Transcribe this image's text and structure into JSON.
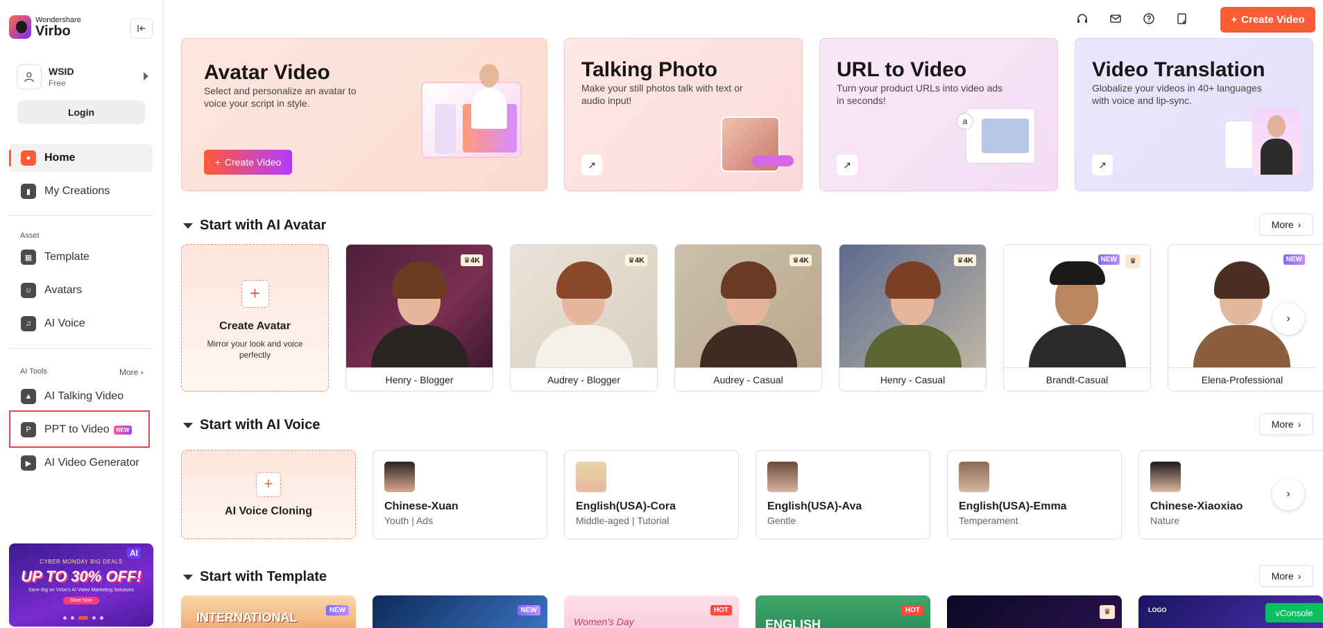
{
  "app": {
    "brand": "Wondershare",
    "product": "Virbo",
    "accent_color": "#ff5a36"
  },
  "user": {
    "name": "WSID",
    "plan": "Free",
    "login_label": "Login"
  },
  "sidebar": {
    "main_items": [
      {
        "label": "Home",
        "icon": "home-icon",
        "active": true
      },
      {
        "label": "My Creations",
        "icon": "folder-icon",
        "active": false
      }
    ],
    "asset_label": "Asset",
    "asset_items": [
      {
        "label": "Template",
        "icon": "template-icon"
      },
      {
        "label": "Avatars",
        "icon": "avatar-icon"
      },
      {
        "label": "AI Voice",
        "icon": "voice-icon"
      }
    ],
    "tools_label": "AI Tools",
    "tools_more": "More",
    "tool_items": [
      {
        "label": "AI Talking Video",
        "icon": "talking-video-icon"
      },
      {
        "label": "PPT to Video",
        "icon": "ppt-icon",
        "badge": "NEW"
      },
      {
        "label": "AI Video Generator",
        "icon": "video-generator-icon"
      }
    ],
    "promo": {
      "line1": "CYBER MONDAY BIG DEALS",
      "line2": "UP TO 30% OFF!",
      "line3": "Save Big on Virbo's AI Video Marketing Solutions",
      "cta": "Save Now",
      "tag": "AI"
    }
  },
  "topbar": {
    "icons": [
      "headset-icon",
      "mail-icon",
      "help-icon",
      "download-icon"
    ],
    "create_label": "Create Video"
  },
  "features": [
    {
      "title": "Avatar Video",
      "desc": "Select and personalize an avatar to voice your script in style.",
      "button": "Create Video"
    },
    {
      "title": "Talking Photo",
      "desc": "Make your still photos talk with text or audio input!"
    },
    {
      "title": "URL to Video",
      "desc": "Turn your product URLs into video ads in seconds!"
    },
    {
      "title": "Video Translation",
      "desc": "Globalize your videos in 40+ languages with voice and lip-sync."
    }
  ],
  "avatar_section": {
    "title": "Start with AI Avatar",
    "more": "More",
    "create_title": "Create Avatar",
    "create_desc": "Mirror your look and voice perfectly",
    "avatars": [
      {
        "name": "Henry - Blogger",
        "badge": "4K"
      },
      {
        "name": "Audrey - Blogger",
        "badge": "4K"
      },
      {
        "name": "Audrey - Casual",
        "badge": "4K"
      },
      {
        "name": "Henry - Casual",
        "badge": "4K"
      },
      {
        "name": "Brandt-Casual",
        "badge": "NEW"
      },
      {
        "name": "Elena-Professional",
        "badge": "NEW"
      }
    ]
  },
  "voice_section": {
    "title": "Start with AI Voice",
    "more": "More",
    "create_title": "AI Voice Cloning",
    "voices": [
      {
        "name": "Chinese-Xuan",
        "tags": "Youth | Ads"
      },
      {
        "name": "English(USA)-Cora",
        "tags": "Middle-aged | Tutorial"
      },
      {
        "name": "English(USA)-Ava",
        "tags": "Gentle"
      },
      {
        "name": "English(USA)-Emma",
        "tags": "Temperament"
      },
      {
        "name": "Chinese-Xiaoxiao",
        "tags": "Nature"
      }
    ]
  },
  "template_section": {
    "title": "Start with Template",
    "more": "More",
    "templates": [
      {
        "text": "INTERNATIONAL",
        "badge": "NEW"
      },
      {
        "text": "",
        "badge": "NEW"
      },
      {
        "text": "Women's Day",
        "badge": "HOT"
      },
      {
        "text": "ENGLISH",
        "badge": "HOT"
      },
      {
        "text": "",
        "badge": ""
      },
      {
        "text": "LOGO",
        "badge": ""
      }
    ]
  },
  "vconsole": "vConsole"
}
